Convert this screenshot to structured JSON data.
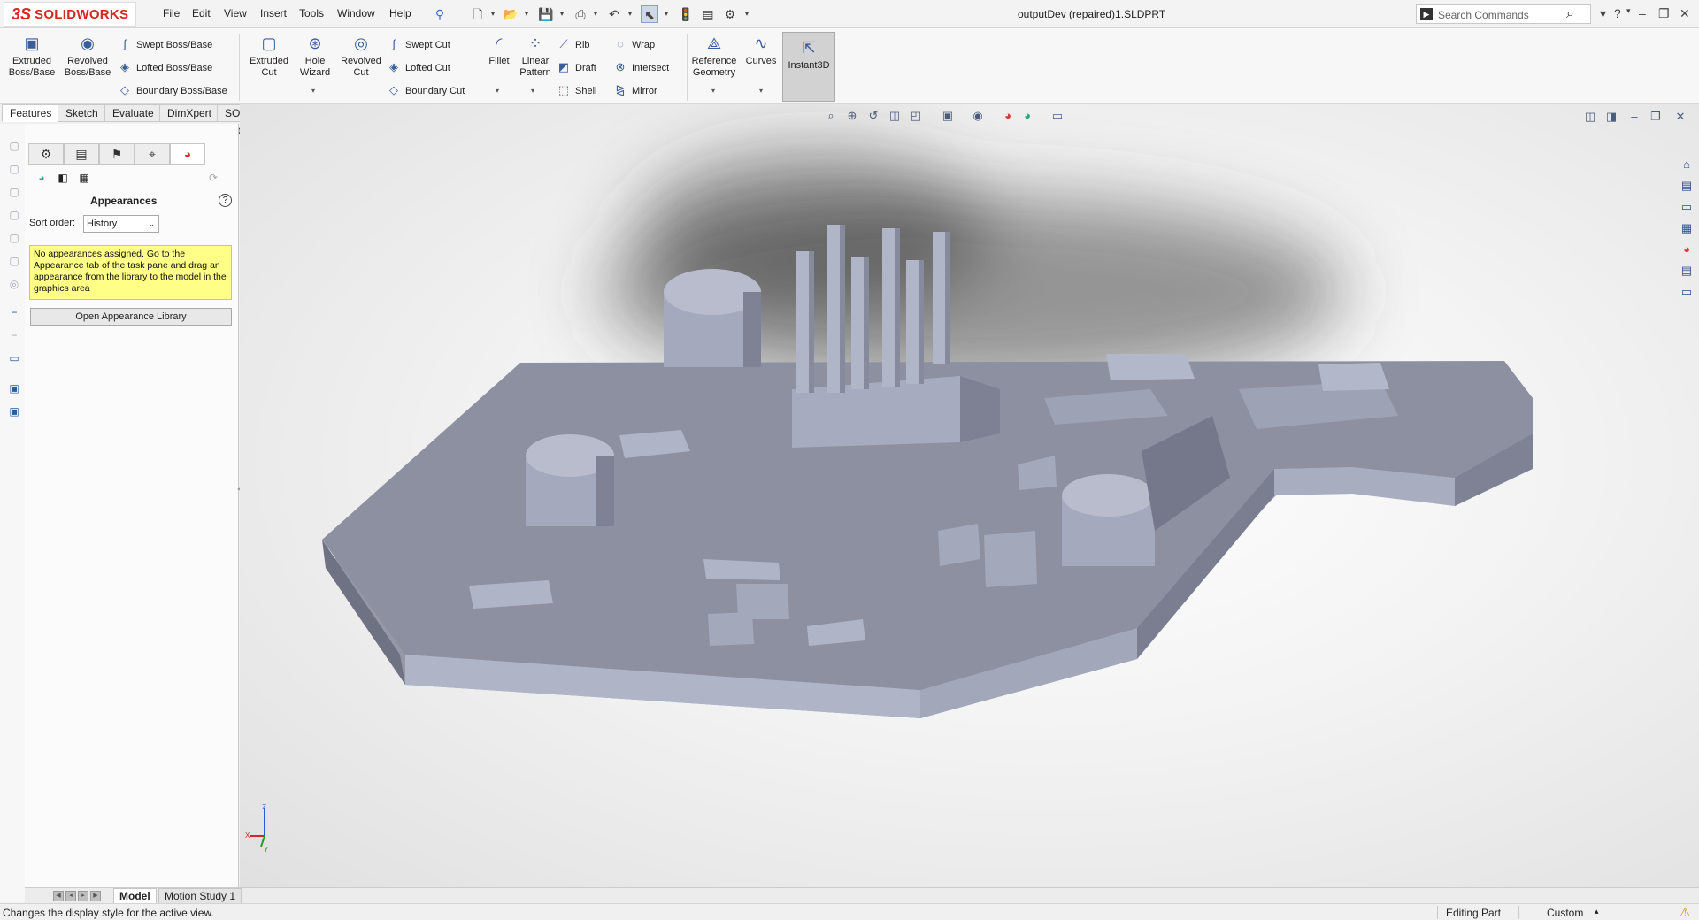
{
  "app": {
    "brand": "SOLIDWORKS",
    "document_title": "outputDev (repaired)1.SLDPRT"
  },
  "menu": [
    "File",
    "Edit",
    "View",
    "Insert",
    "Tools",
    "Window",
    "Help"
  ],
  "search": {
    "placeholder": "Search Commands"
  },
  "ribbon": {
    "extruded_boss": "Extruded Boss/Base",
    "revolved_boss": "Revolved Boss/Base",
    "swept_boss": "Swept Boss/Base",
    "lofted_boss": "Lofted Boss/Base",
    "boundary_boss": "Boundary Boss/Base",
    "extruded_cut": "Extruded Cut",
    "hole_wizard": "Hole Wizard",
    "revolved_cut": "Revolved Cut",
    "swept_cut": "Swept Cut",
    "lofted_cut": "Lofted Cut",
    "boundary_cut": "Boundary Cut",
    "fillet": "Fillet",
    "linear_pattern": "Linear Pattern",
    "rib": "Rib",
    "draft": "Draft",
    "shell": "Shell",
    "wrap": "Wrap",
    "intersect": "Intersect",
    "mirror": "Mirror",
    "reference_geometry": "Reference Geometry",
    "curves": "Curves",
    "instant3d": "Instant3D"
  },
  "tabs": [
    "Features",
    "Sketch",
    "Evaluate",
    "DimXpert",
    "SOLIDWORKS Add-Ins"
  ],
  "panel": {
    "title": "Appearances",
    "sort_label": "Sort order:",
    "sort_value": "History",
    "note": "No appearances assigned. Go to the Appearance tab of the task pane and drag an appearance from the library to the model in the graphics area",
    "open_library": "Open Appearance Library"
  },
  "bottom_tabs": [
    "Model",
    "Motion Study 1"
  ],
  "status": {
    "message": "Changes the display style for the active view.",
    "mode": "Editing Part",
    "units": "Custom"
  },
  "triad": {
    "x": "X",
    "y": "Y",
    "z": "Z"
  },
  "colors": {
    "brand_red": "#d7261e",
    "model_gray": "#8d90a0",
    "note_yellow": "#ffff88"
  }
}
